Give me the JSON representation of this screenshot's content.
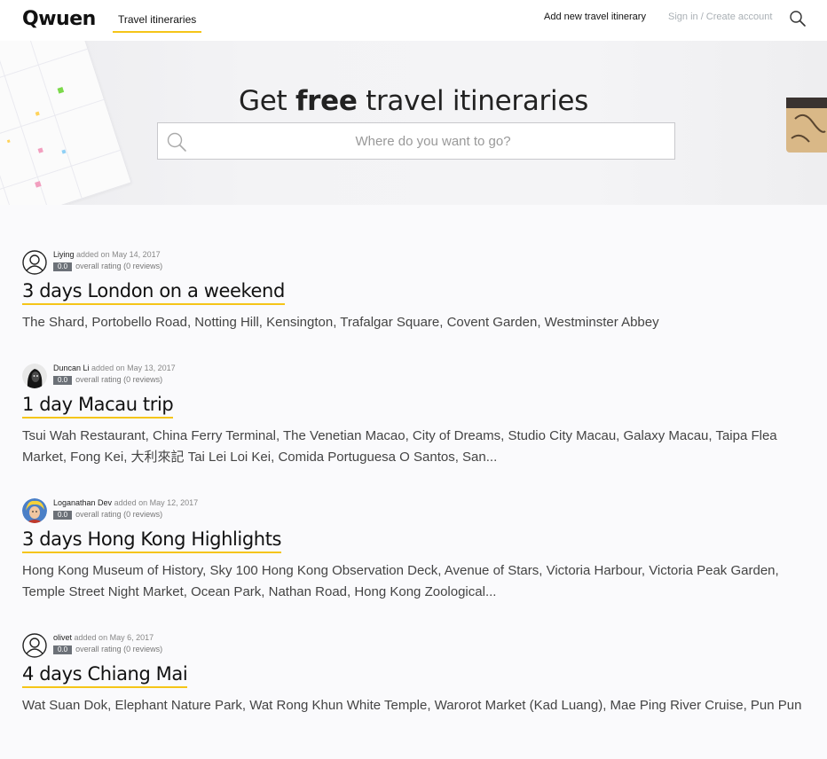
{
  "header": {
    "logo": "Qwuen",
    "tab": "Travel itineraries",
    "add_link": "Add new travel itinerary",
    "signin_link": "Sign in / Create account",
    "search_icon": "search-icon"
  },
  "hero": {
    "title_pre": "Get ",
    "title_bold": "free",
    "title_post": " travel itineraries",
    "search_placeholder": "Where do you want to go?",
    "search_value": ""
  },
  "colors": {
    "accent": "#f5c518",
    "rating_bg": "#6c7178"
  },
  "listings": [
    {
      "user": "Liying",
      "added": "added on May 14, 2017",
      "rating": "0.0",
      "rating_text": "overall rating (0 reviews)",
      "title": "3 days London on a weekend",
      "places": "The Shard, Portobello Road, Notting Hill, Kensington, Trafalgar Square, Covent Garden, Westminster Abbey",
      "avatar": "default-user-avatar"
    },
    {
      "user": "Duncan Li",
      "added": "added on May 13, 2017",
      "rating": "0.0",
      "rating_text": "overall rating (0 reviews)",
      "title": "1 day Macau trip",
      "places": "Tsui Wah Restaurant, China Ferry Terminal, The Venetian Macao, City of Dreams, Studio City Macau, Galaxy Macau, Taipa Flea Market, Fong Kei, 大利來記 Tai Lei Loi Kei, Comida Portuguesa O Santos, San...",
      "avatar": "photo-avatar"
    },
    {
      "user": "Loganathan Dev",
      "added": "added on May 12, 2017",
      "rating": "0.0",
      "rating_text": "overall rating (0 reviews)",
      "title": "3 days Hong Kong Highlights",
      "places": "Hong Kong Museum of History, Sky 100 Hong Kong Observation Deck, Avenue of Stars, Victoria Harbour, Victoria Peak Garden, Temple Street Night Market, Ocean Park, Nathan Road, Hong Kong Zoological...",
      "avatar": "illustrated-avatar"
    },
    {
      "user": "olivet",
      "added": "added on May 6, 2017",
      "rating": "0.0",
      "rating_text": "overall rating (0 reviews)",
      "title": "4 days Chiang Mai",
      "places": "Wat Suan Dok, Elephant Nature Park, Wat Rong Khun White Temple, Warorot Market (Kad Luang), Mae Ping River Cruise, Pun Pun",
      "avatar": "default-user-avatar"
    }
  ]
}
